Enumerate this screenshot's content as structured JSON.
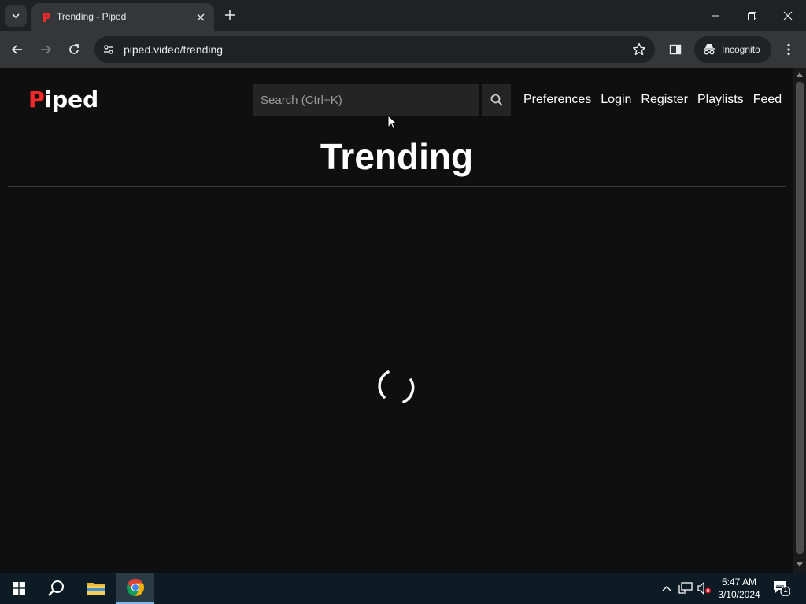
{
  "browser": {
    "tab_title": "Trending - Piped",
    "url": "piped.video/trending",
    "incognito_label": "Incognito"
  },
  "page": {
    "logo_first": "P",
    "logo_rest": "iped",
    "search_placeholder": "Search (Ctrl+K)",
    "nav": [
      "Preferences",
      "Login",
      "Register",
      "Playlists",
      "Feed"
    ],
    "title": "Trending"
  },
  "taskbar": {
    "time": "5:47 AM",
    "date": "3/10/2024",
    "notification_count": "1"
  },
  "colors": {
    "accent_red": "#ef2b2b",
    "page_bg": "#0f0f0f",
    "chrome_bg": "#202124"
  }
}
